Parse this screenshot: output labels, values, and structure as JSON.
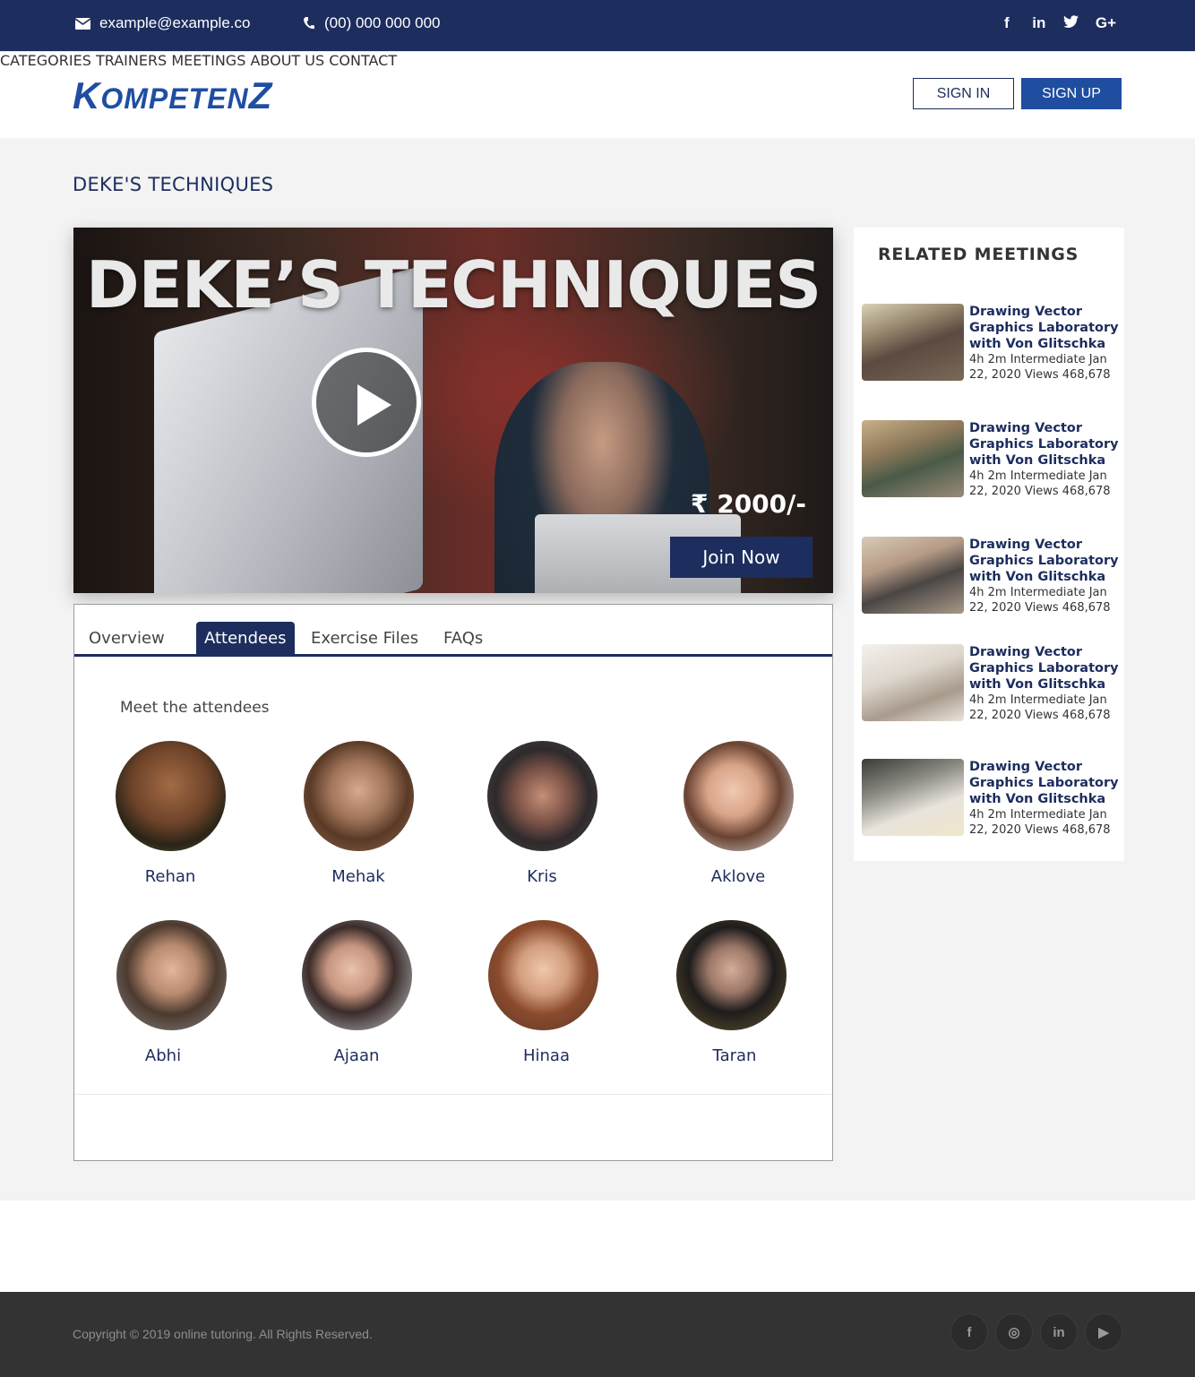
{
  "topbar": {
    "email": "example@example.co",
    "phone": "(00) 000 000 000",
    "socials": [
      "f",
      "in",
      "t",
      "G+"
    ]
  },
  "header": {
    "logo": {
      "k": "K",
      "ompeten": "OMPETEN",
      "z": "Z"
    },
    "nav": [
      "CATEGORIES",
      "TRAINERS",
      "MEETINGS",
      "ABOUT US",
      "CONTACT"
    ],
    "sign_in": "SIGN  IN",
    "sign_up": "SIGN UP"
  },
  "page": {
    "title": "DEKE'S TECHNIQUES"
  },
  "hero": {
    "title": "DEKE’S TECHNIQUES",
    "price": "₹ 2000/-",
    "join": "Join Now"
  },
  "tabs": [
    "Overview",
    "Attendees",
    "Exercise Files",
    "FAQs"
  ],
  "attendees_heading": "Meet the attendees",
  "attendees": [
    {
      "name": "Rehan"
    },
    {
      "name": "Mehak"
    },
    {
      "name": "Kris"
    },
    {
      "name": "Aklove"
    },
    {
      "name": "Abhi"
    },
    {
      "name": "Ajaan"
    },
    {
      "name": "Hinaa"
    },
    {
      "name": "Taran"
    }
  ],
  "related": {
    "heading": "RELATED  MEETINGS",
    "items": [
      {
        "title": "Drawing Vector Graphics Laboratory with Von Glitschka",
        "meta": "4h 2m Intermediate Jan 22, 2020 Views 468,678"
      },
      {
        "title": "Drawing Vector Graphics Laboratory with Von Glitschka",
        "meta": "4h 2m Intermediate Jan 22, 2020 Views 468,678"
      },
      {
        "title": "Drawing Vector Graphics Laboratory with Von Glitschka",
        "meta": "4h 2m Intermediate Jan 22, 2020 Views 468,678"
      },
      {
        "title": "Drawing Vector Graphics Laboratory with Von Glitschka",
        "meta": "4h 2m Intermediate Jan 22, 2020 Views 468,678"
      },
      {
        "title": "Drawing Vector Graphics Laboratory with Von Glitschka",
        "meta": "4h 2m Intermediate Jan 22, 2020 Views 468,678"
      }
    ]
  },
  "footer": {
    "copyright": "Copyright © 2019 online tutoring. All Rights Reserved.",
    "socials": [
      "f",
      "◎",
      "in",
      "▶"
    ]
  },
  "colors": {
    "primary": "#1c2d5e",
    "accent": "#1f4ea1",
    "footer": "#333333"
  }
}
